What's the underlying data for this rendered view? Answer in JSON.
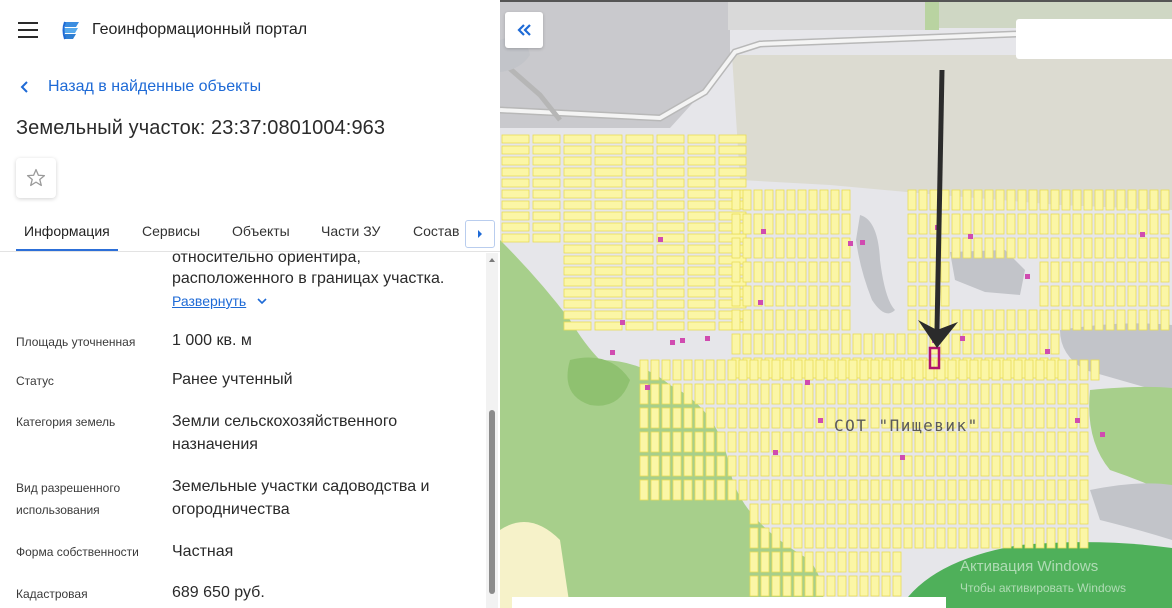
{
  "app": {
    "title": "Геоинформационный портал"
  },
  "nav": {
    "back_label": "Назад в найденные объекты"
  },
  "object": {
    "title": "Земельный участок: 23:37:0801004:963"
  },
  "tabs": [
    {
      "label": "Информация",
      "active": true
    },
    {
      "label": "Сервисы",
      "active": false
    },
    {
      "label": "Объекты",
      "active": false
    },
    {
      "label": "Части ЗУ",
      "active": false
    },
    {
      "label": "Состав",
      "active": false
    }
  ],
  "details": {
    "location_line1": "относительно ориентира,",
    "location_line2": "расположенного в границах участка.",
    "expand_label": "Развернуть",
    "rows": [
      {
        "label": "Площадь уточненная",
        "value": "1 000 кв. м"
      },
      {
        "label": "Статус",
        "value": "Ранее учтенный"
      },
      {
        "label": "Категория земель",
        "value_line1": "Земли сельскохозяйственного",
        "value_line2": "назначения"
      },
      {
        "label_line1": "Вид разрешенного",
        "label_line2": "использования",
        "value_line1": "Земельные участки садоводства и",
        "value_line2": "огородничества"
      },
      {
        "label": "Форма собственности",
        "value": "Частная"
      },
      {
        "label": "Кадастровая",
        "value": "689 650 руб."
      }
    ]
  },
  "map": {
    "area_label": "СОТ  \"Пищевик\"",
    "watermark_line1": "Активация Windows",
    "watermark_line2": "Чтобы активировать Windows",
    "colors": {
      "background": "#e6e6ea",
      "parcel_fill": "#fbf6a6",
      "parcel_stroke": "#e9dc55",
      "forest": "#a7cf8b",
      "water": "#c2c4c9",
      "road": "#cfcfcf",
      "highlight": "#b0126d",
      "accent": "#1e6ad6"
    }
  },
  "icons": {
    "menu": "menu-icon",
    "logo": "portal-logo",
    "back": "chevron-left-icon",
    "favorite": "star-icon",
    "tab_scroll": "chevron-right-icon",
    "collapse": "double-chevron-left-icon",
    "expand": "chevron-down-icon"
  }
}
